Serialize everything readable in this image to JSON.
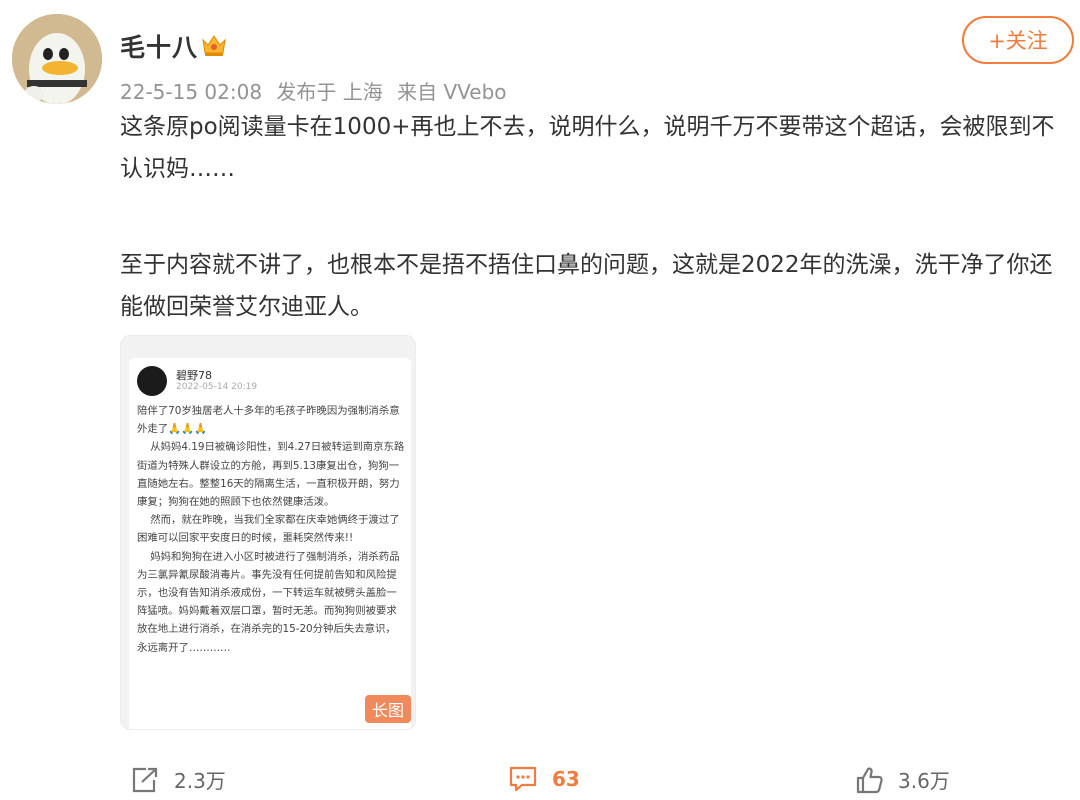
{
  "post": {
    "username": "毛十八",
    "date": "22-5-15 02:08",
    "location": "发布于 上海",
    "source": "来自 VVebo",
    "follow_label": "+关注",
    "paragraph1": "这条原po阅读量卡在1000+再也上不去，说明什么，说明千万不要带这个超话，会被限到不认识妈……",
    "paragraph2": "至于内容就不讲了，也根本不是捂不捂住口鼻的问题，这就是2022年的洗澡，洗干净了你还能做回荣誉艾尔迪亚人。"
  },
  "image": {
    "name": "碧野78",
    "date": "2022-05-14 20:19",
    "text": "陪伴了70岁独居老人十多年的毛孩子昨晚因为强制消杀意外走了🙏🙏🙏\n    从妈妈4.19日被确诊阳性，到4.27日被转运到南京东路街道为特殊人群设立的方舱，再到5.13康复出仓，狗狗一直随她左右。整整16天的隔离生活，一直积极开朗，努力康复；狗狗在她的照顾下也依然健康活泼。\n    然而，就在昨晚，当我们全家都在庆幸她俩终于渡过了困难可以回家平安度日的时候，噩耗突然传来!!\n    妈妈和狗狗在进入小区时被进行了强制消杀，消杀药品为三氯异氰尿酸消毒片。事先没有任何提前告知和风险提示，也没有告知消杀液成份，一下转运车就被劈头盖脸一阵猛喷。妈妈戴着双层口罩，暂时无恙。而狗狗则被要求放在地上进行消杀，在消杀完的15-20分钟后失去意识，永远离开了…………",
    "badge": "长图"
  },
  "actions": {
    "share_count": "2.3万",
    "comment_count": "63",
    "like_count": "3.6万"
  },
  "colors": {
    "accent": "#f07c3e",
    "meta": "#939393"
  }
}
